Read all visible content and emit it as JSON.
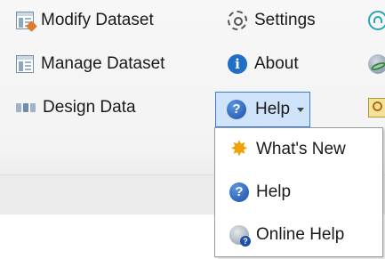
{
  "ribbon": {
    "modify_dataset": "Modify Dataset",
    "manage_dataset": "Manage Dataset",
    "design_data": "Design Data",
    "settings": "Settings",
    "about": "About",
    "help": "Help"
  },
  "help_menu": {
    "items": [
      {
        "label": "What's New",
        "icon": "new-star-icon"
      },
      {
        "label": "Help",
        "icon": "help-icon"
      },
      {
        "label": "Online Help",
        "icon": "online-help-icon"
      }
    ]
  },
  "colors": {
    "selected_button_bg": "#cfe4fb",
    "selected_button_border": "#3a7bd5",
    "ribbon_bg": "#f3f3f3"
  }
}
